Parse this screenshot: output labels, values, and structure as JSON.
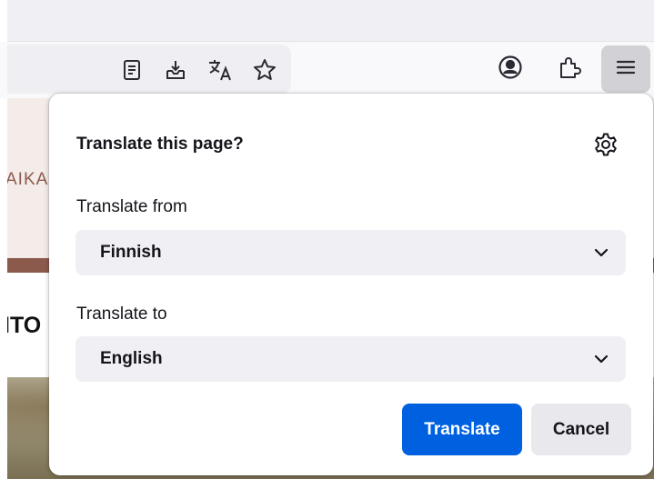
{
  "page_background": {
    "nav_text": "AIKA",
    "heading_text": "ITO"
  },
  "toolbar": {
    "url_icons": [
      "reader-view-icon",
      "save-to-pocket-icon",
      "translate-icon",
      "bookmark-star-icon"
    ],
    "right_buttons": [
      "account-icon",
      "extensions-icon",
      "menu-icon"
    ]
  },
  "translate_popup": {
    "title": "Translate this page?",
    "from_label": "Translate from",
    "from_value": "Finnish",
    "to_label": "Translate to",
    "to_value": "English",
    "translate_button": "Translate",
    "cancel_button": "Cancel"
  },
  "colors": {
    "primary_button": "#0061e0",
    "select_background": "#f0f0f4",
    "menu_button_active": "#d1d1d6",
    "page_accent_brown": "#8b5a4d"
  }
}
